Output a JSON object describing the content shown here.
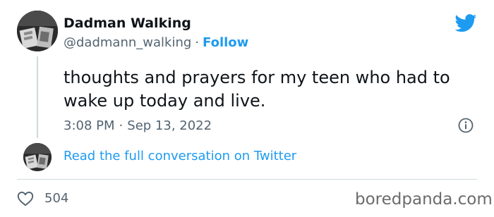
{
  "author": {
    "display_name": "Dadman Walking",
    "handle": "@dadmann_walking",
    "separator": "·",
    "follow_label": "Follow"
  },
  "tweet": {
    "text": "thoughts and prayers for my teen who had to wake up today and live.",
    "time": "3:08 PM",
    "separator": "·",
    "date": "Sep 13, 2022"
  },
  "conversation_link": "Read the full conversation on Twitter",
  "likes": {
    "count": "504"
  },
  "watermark": "boredpanda.com",
  "icons": {
    "brand": "twitter-bird-icon",
    "info": "info-icon",
    "like": "heart-icon"
  },
  "colors": {
    "accent": "#1d9bf0",
    "text_primary": "#0f1419",
    "text_secondary": "#536471",
    "divider": "#cfd9de"
  }
}
